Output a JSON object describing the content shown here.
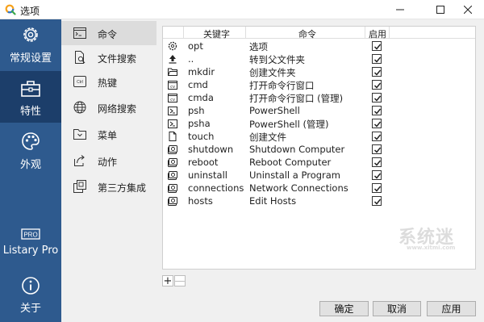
{
  "window": {
    "title": "选项",
    "controls": {
      "minimize": "minimize",
      "maximize": "maximize",
      "close": "close"
    }
  },
  "sidebar": {
    "items": [
      {
        "label": "常规设置",
        "icon": "gear-icon"
      },
      {
        "label": "特性",
        "icon": "toolbox-icon",
        "active": true
      },
      {
        "label": "外观",
        "icon": "palette-icon"
      },
      {
        "label": "Listary Pro",
        "icon": "pro-badge-icon"
      },
      {
        "label": "关于",
        "icon": "info-icon"
      }
    ],
    "pro_badge_text": "PRO",
    "colors": {
      "background": "#2e5a8e",
      "active": "#1c3e6a"
    }
  },
  "subnav": {
    "items": [
      {
        "label": "命令",
        "icon": "command-window-icon",
        "active": true
      },
      {
        "label": "文件搜索",
        "icon": "file-search-icon"
      },
      {
        "label": "热键",
        "icon": "keyboard-ctrl-icon"
      },
      {
        "label": "网络搜索",
        "icon": "globe-icon"
      },
      {
        "label": "菜单",
        "icon": "menu-folder-icon"
      },
      {
        "label": "动作",
        "icon": "share-arrow-icon"
      },
      {
        "label": "第三方集成",
        "icon": "plugin-icon"
      }
    ],
    "ctrl_text": "Ctrl"
  },
  "grid": {
    "columns": [
      "关键字",
      "命令",
      "启用"
    ],
    "rows": [
      {
        "icon": "gear-icon",
        "keyword": "opt",
        "command": "选项",
        "enabled": true
      },
      {
        "icon": "up-arrow-icon",
        "keyword": "..",
        "command": "转到父文件夹",
        "enabled": true
      },
      {
        "icon": "folder-icon",
        "keyword": "mkdir",
        "command": "创建文件夹",
        "enabled": true
      },
      {
        "icon": "cmd-icon",
        "keyword": "cmd",
        "command": "打开命令行窗口",
        "enabled": true
      },
      {
        "icon": "cmd-icon",
        "keyword": "cmda",
        "command": "打开命令行窗口 (管理)",
        "enabled": true
      },
      {
        "icon": "powershell-icon",
        "keyword": "psh",
        "command": "PowerShell",
        "enabled": true
      },
      {
        "icon": "powershell-icon",
        "keyword": "psha",
        "command": "PowerShell (管理)",
        "enabled": true
      },
      {
        "icon": "new-file-icon",
        "keyword": "touch",
        "command": "创建文件",
        "enabled": true
      },
      {
        "icon": "run-icon",
        "keyword": "shutdown",
        "command": "Shutdown Computer",
        "enabled": true
      },
      {
        "icon": "run-icon",
        "keyword": "reboot",
        "command": "Reboot Computer",
        "enabled": true
      },
      {
        "icon": "run-icon",
        "keyword": "uninstall",
        "command": "Uninstall a Program",
        "enabled": true
      },
      {
        "icon": "run-icon",
        "keyword": "connections",
        "command": "Network Connections",
        "enabled": true
      },
      {
        "icon": "run-icon",
        "keyword": "hosts",
        "command": "Edit Hosts",
        "enabled": true
      }
    ],
    "add_label": "+",
    "remove_label": "—"
  },
  "footer": {
    "ok_label": "确定",
    "cancel_label": "取消",
    "apply_label": "应用"
  },
  "watermark": {
    "line1": "系统迷",
    "line2": "www.xitmi.com"
  }
}
